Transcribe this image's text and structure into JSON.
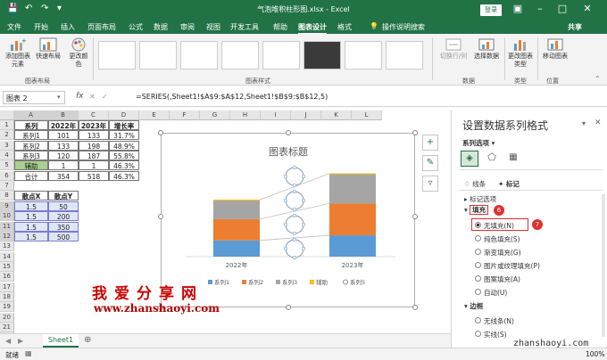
{
  "titlebar": {
    "title": "气泡堆积柱形图.xlsx  -  Excel",
    "login": "登录"
  },
  "menu": {
    "tabs": [
      "文件",
      "开始",
      "插入",
      "页面布局",
      "公式",
      "数据",
      "审阅",
      "视图",
      "开发工具",
      "帮助",
      "图表设计",
      "格式"
    ],
    "active": "图表设计",
    "search": "操作说明搜索",
    "share": "共享"
  },
  "ribbon": {
    "add_chart_element": "添加图表元素",
    "quick_layout": "快速布局",
    "change_colors": "更改颜色",
    "group_layout": "图表布局",
    "group_styles": "图表样式",
    "switch_rowcol": "切换行/列",
    "select_data": "选择数据",
    "group_data": "数据",
    "change_type": "更改图表类型",
    "group_type": "类型",
    "move_chart": "移动图表",
    "group_location": "位置"
  },
  "formula_bar": {
    "name_box": "图表 2",
    "fx": "fx",
    "formula": "=SERIES(,Sheet1!$A$9:$A$12,Sheet1!$B$9:$B$12,5)"
  },
  "sheet": {
    "columns": [
      "A",
      "B",
      "C",
      "D",
      "E",
      "F",
      "G",
      "H",
      "I",
      "J",
      "K",
      "L"
    ],
    "rows": [
      "1",
      "2",
      "3",
      "4",
      "5",
      "6",
      "7",
      "8",
      "9",
      "10",
      "11",
      "12",
      "13",
      "14",
      "15",
      "16",
      "17",
      "18",
      "19",
      "20",
      "21",
      "22"
    ],
    "table1_header": [
      "系列",
      "2022年",
      "2023年",
      "增长率"
    ],
    "table1_rows": [
      [
        "系列1",
        "101",
        "133",
        "31.7%"
      ],
      [
        "系列2",
        "133",
        "198",
        "48.9%"
      ],
      [
        "系列3",
        "120",
        "187",
        "55.8%"
      ],
      [
        "辅助",
        "1",
        "1",
        "46.3%"
      ],
      [
        "合计",
        "354",
        "518",
        "46.3%"
      ]
    ],
    "table2_header": [
      "散点X",
      "散点Y"
    ],
    "table2_rows": [
      [
        "1.5",
        "50"
      ],
      [
        "1.5",
        "200"
      ],
      [
        "1.5",
        "350"
      ],
      [
        "1.5",
        "500"
      ]
    ],
    "tab_name": "Sheet1"
  },
  "chart_data": {
    "type": "bar",
    "stacked": true,
    "title": "图表标题",
    "categories": [
      "2022年",
      "2023年"
    ],
    "series": [
      {
        "name": "系列1",
        "values": [
          101,
          133
        ],
        "color": "#5b9bd5"
      },
      {
        "name": "系列2",
        "values": [
          133,
          198
        ],
        "color": "#ed7d31"
      },
      {
        "name": "系列3",
        "values": [
          120,
          187
        ],
        "color": "#a5a5a5"
      },
      {
        "name": "辅助",
        "values": [
          1,
          1
        ],
        "color": "#ffc000"
      }
    ],
    "scatter_series": {
      "name": "系列5",
      "x": [
        1.5,
        1.5,
        1.5,
        1.5
      ],
      "y": [
        50,
        200,
        350,
        500
      ]
    },
    "ylim": [
      0,
      600
    ],
    "grid": false,
    "legend": "bottom"
  },
  "pane": {
    "title": "设置数据系列格式",
    "series_options": "系列选项",
    "tab_line": "线条",
    "tab_marker": "标记",
    "marker_options": "标记选项",
    "fill": "填充",
    "fill_options": [
      "无填充(N)",
      "纯色填充(S)",
      "渐变填充(G)",
      "图片或纹理填充(P)",
      "图案填充(A)",
      "自动(U)"
    ],
    "border": "边框",
    "border_options": [
      "无线条(N)",
      "实线(S)"
    ],
    "badge6": "6",
    "badge7": "7"
  },
  "status": {
    "ready": "就绪",
    "zoom": "100%"
  },
  "watermarks": {
    "big": "我爱分享网",
    "url": "www.zhanshaoyi.com",
    "corner": "zhanshaoyi.com"
  },
  "colors": {
    "excel_green": "#217346",
    "accent_red": "#e03030"
  }
}
